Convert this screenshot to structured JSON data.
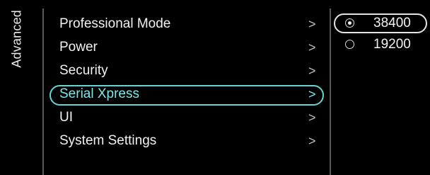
{
  "section": {
    "title": "Advanced"
  },
  "menu": {
    "items": [
      {
        "label": "Professional Mode"
      },
      {
        "label": "Power"
      },
      {
        "label": "Security"
      },
      {
        "label": "Serial Xpress"
      },
      {
        "label": "UI"
      },
      {
        "label": "System Settings"
      }
    ],
    "selected_index": 3,
    "chevron": ">"
  },
  "options": {
    "items": [
      {
        "value": "38400",
        "checked": true
      },
      {
        "value": "19200",
        "checked": false
      }
    ]
  },
  "colors": {
    "background": "#000000",
    "accent": "#63d4d7",
    "text": "#f2f2f2",
    "divider": "#5a5a5a"
  }
}
